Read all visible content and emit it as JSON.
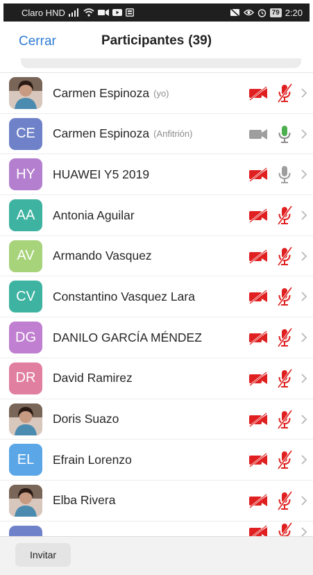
{
  "status_bar": {
    "carrier": "Claro HND",
    "battery": "79",
    "time": "2:20",
    "icons": [
      "signal-icon",
      "wifi-icon",
      "video-icon",
      "youtube-icon",
      "gallery-icon",
      "no-image-icon",
      "eye-icon",
      "alarm-icon",
      "battery-icon"
    ]
  },
  "header": {
    "close_label": "Cerrar",
    "title": "Participantes",
    "count": "(39)"
  },
  "colors": {
    "accent_blue": "#2d7bd6",
    "muted_red": "#e02020",
    "mic_on_green": "#4caf50",
    "icon_gray": "#9e9e9e"
  },
  "participants": [
    {
      "initials": "",
      "photo": true,
      "name": "Carmen Espinoza",
      "role": "(yo)",
      "video": "muted",
      "mic": "muted"
    },
    {
      "initials": "CE",
      "photo": false,
      "color": "#6f82c9",
      "name": "Carmen Espinoza",
      "role": "(Anfitrión)",
      "video": "off",
      "mic": "on"
    },
    {
      "initials": "HY",
      "photo": false,
      "color": "#b57fcf",
      "name": "HUAWEI Y5 2019",
      "role": "",
      "video": "muted",
      "mic": "idle"
    },
    {
      "initials": "AA",
      "photo": false,
      "color": "#3eb3a1",
      "name": "Antonia Aguilar",
      "role": "",
      "video": "muted",
      "mic": "muted"
    },
    {
      "initials": "AV",
      "photo": false,
      "color": "#a7d37a",
      "name": "Armando Vasquez",
      "role": "",
      "video": "muted",
      "mic": "muted"
    },
    {
      "initials": "CV",
      "photo": false,
      "color": "#3eb3a1",
      "name": "Constantino Vasquez Lara",
      "role": "",
      "video": "muted",
      "mic": "muted"
    },
    {
      "initials": "DG",
      "photo": false,
      "color": "#c07fd0",
      "name": "DANILO GARCÍA MÉNDEZ",
      "role": "",
      "video": "muted",
      "mic": "muted"
    },
    {
      "initials": "DR",
      "photo": false,
      "color": "#e17fa1",
      "name": "David Ramirez",
      "role": "",
      "video": "muted",
      "mic": "muted"
    },
    {
      "initials": "",
      "photo": true,
      "name": "Doris Suazo",
      "role": "",
      "video": "muted",
      "mic": "muted"
    },
    {
      "initials": "EL",
      "photo": false,
      "color": "#5aa6e6",
      "name": "Efrain Lorenzo",
      "role": "",
      "video": "muted",
      "mic": "muted"
    },
    {
      "initials": "",
      "photo": true,
      "name": "Elba Rivera",
      "role": "",
      "video": "muted",
      "mic": "muted"
    }
  ],
  "footer": {
    "invite_label": "Invitar"
  }
}
